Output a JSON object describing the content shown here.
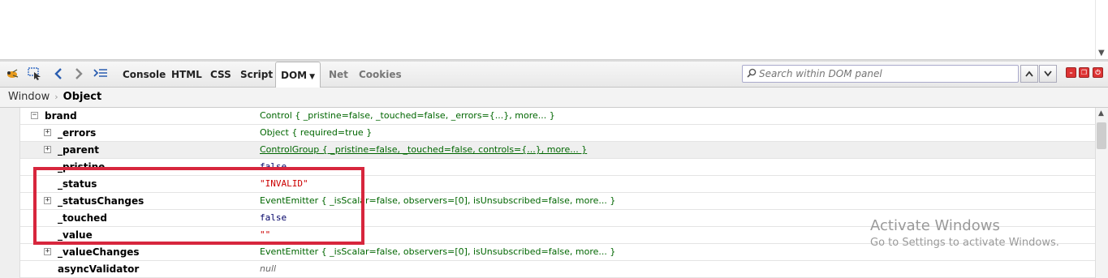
{
  "toolbar": {
    "tabs": [
      "Console",
      "HTML",
      "CSS",
      "Script",
      "DOM",
      "Net",
      "Cookies"
    ],
    "active_tab": "DOM",
    "search_placeholder": "Search within DOM panel"
  },
  "breadcrumb": {
    "items": [
      "Window",
      "Object"
    ]
  },
  "tree": {
    "rows": [
      {
        "name": "brand",
        "value": "Control { _pristine=false, _touched=false, _errors={...}, more... }",
        "twisty": "−",
        "type": "object"
      },
      {
        "name": "_errors",
        "value": "Object { required=true }",
        "twisty": "+",
        "type": "object"
      },
      {
        "name": "_parent",
        "value": "ControlGroup { _pristine=false, _touched=false, controls={...}, more... }",
        "twisty": "+",
        "type": "link"
      },
      {
        "name": "_pristine",
        "value": "false",
        "twisty": "",
        "type": "bool"
      },
      {
        "name": "_status",
        "value": "\"INVALID\"",
        "twisty": "",
        "type": "string"
      },
      {
        "name": "_statusChanges",
        "value": "EventEmitter { _isScalar=false, observers=[0], isUnsubscribed=false, more... }",
        "twisty": "+",
        "type": "object"
      },
      {
        "name": "_touched",
        "value": "false",
        "twisty": "",
        "type": "bool"
      },
      {
        "name": "_value",
        "value": "\"\"",
        "twisty": "",
        "type": "string"
      },
      {
        "name": "_valueChanges",
        "value": "EventEmitter { _isScalar=false, observers=[0], isUnsubscribed=false, more... }",
        "twisty": "+",
        "type": "object"
      },
      {
        "name": "asyncValidator",
        "value": "null",
        "twisty": "",
        "type": "null"
      }
    ]
  },
  "watermark": {
    "title": "Activate Windows",
    "subtitle": "Go to Settings to activate Windows."
  },
  "colors": {
    "highlight_box": "#d7263d",
    "object_value": "#006600",
    "string_value": "#cc0000"
  }
}
